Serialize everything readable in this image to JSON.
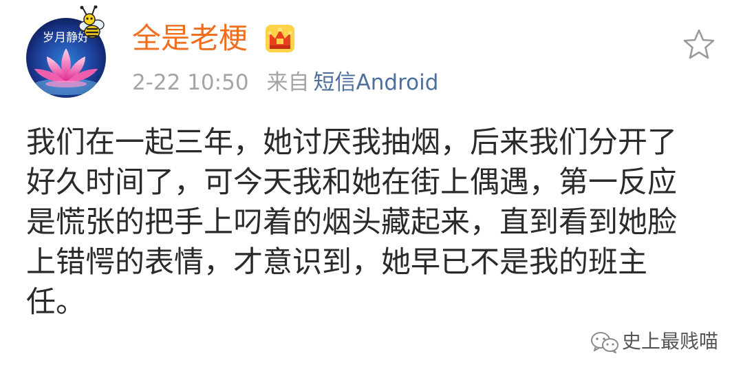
{
  "user": {
    "avatar_caption": "岁月静好",
    "name": "全是老梗"
  },
  "meta": {
    "time": "2-22 10:50",
    "from_label": "来自",
    "source": "短信Android"
  },
  "content": {
    "lines": [
      "我们在一起三年，她讨厌我抽烟，后来我们分开了",
      "好久时间了，可今天我和她在街上偶遇，第一反应",
      "是慌张的把手上叼着的烟头藏起来，直到看到她脸",
      "上错愕的表情，才意识到，她早已不是我的班主",
      "任。"
    ]
  },
  "watermark": {
    "text": "史上最贱喵"
  },
  "icons": {
    "badge": "crown-badge-icon",
    "favorite": "star-outline-icon",
    "watermark": "wechat-icon"
  },
  "colors": {
    "username": "#f06e1e",
    "meta_gray": "#a4a4a4",
    "source_link": "#4d6f9b",
    "body_text": "#2a2a2a"
  }
}
